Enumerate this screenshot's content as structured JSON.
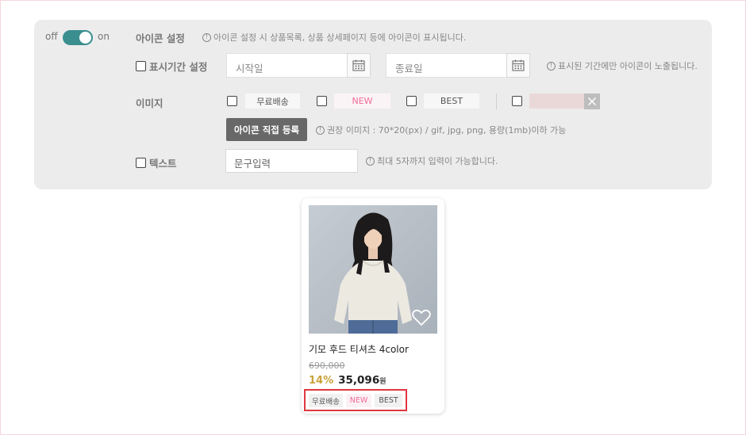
{
  "toggle": {
    "off_label": "off",
    "on_label": "on",
    "state": "on",
    "accent": "#3a8e8e"
  },
  "icon_setting": {
    "label": "아이콘 설정",
    "hint": "아이콘 설정 시 상품목록, 상품 상세페이지 등에 아이콘이 표시됩니다."
  },
  "display_period": {
    "label": "표시기간 설정",
    "start_placeholder": "시작일",
    "end_placeholder": "종료일",
    "hint": "표시된 기간에만 아이콘이 노출됩니다.",
    "calendar_icon": "calendar-icon"
  },
  "image": {
    "label": "이미지",
    "options": [
      {
        "label": "무료배송"
      },
      {
        "label": "NEW",
        "color": "#f06b98"
      },
      {
        "label": "BEST"
      },
      {
        "label": "",
        "swatch": "#ead8d9"
      }
    ],
    "upload_button": "아이콘 직접 등록",
    "hint": "권장 이미지 : 70*20(px) / gif, jpg, png, 용량(1mb)이하 가능",
    "remove_icon": "close-icon"
  },
  "text_option": {
    "label": "텍스트",
    "placeholder": "문구입력",
    "hint": "최대 5자까지 입력이 가능합니다."
  },
  "product": {
    "name": "기모 후드 티셔츠 4color",
    "original_price": "690,000",
    "discount": "14%",
    "price": "35,096",
    "currency": "원",
    "tags": [
      "무료배송",
      "NEW",
      "BEST"
    ],
    "wishlist_icon": "heart-icon"
  }
}
